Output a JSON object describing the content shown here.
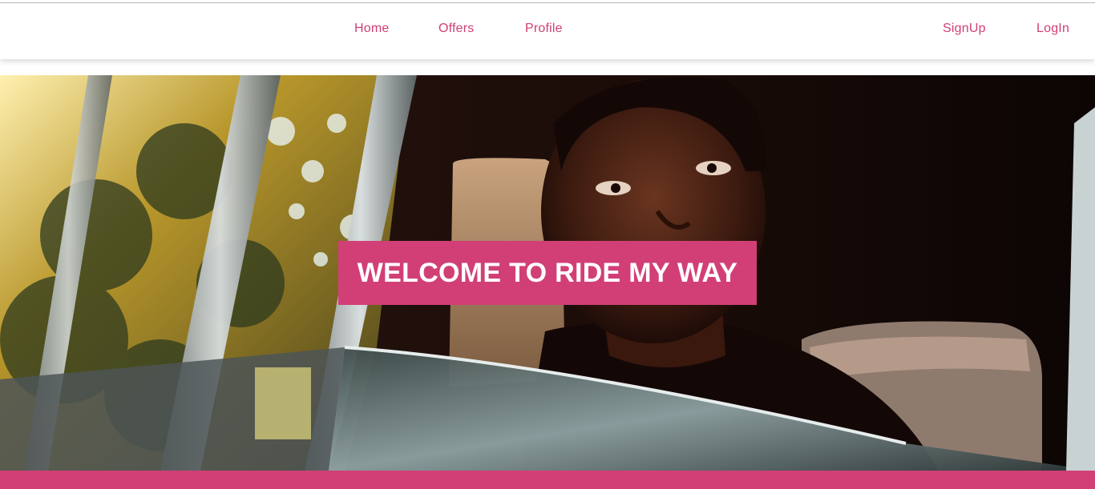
{
  "nav": {
    "home_label": "Home",
    "offers_label": "Offers",
    "profile_label": "Profile",
    "signup_label": "SignUp",
    "login_label": "LogIn"
  },
  "hero": {
    "title": "WELCOME TO RIDE MY WAY",
    "image_icon": "hero-photo"
  },
  "colors": {
    "accent": "#d23f77",
    "nav_text": "#cf3f75",
    "background": "#ffffff"
  }
}
